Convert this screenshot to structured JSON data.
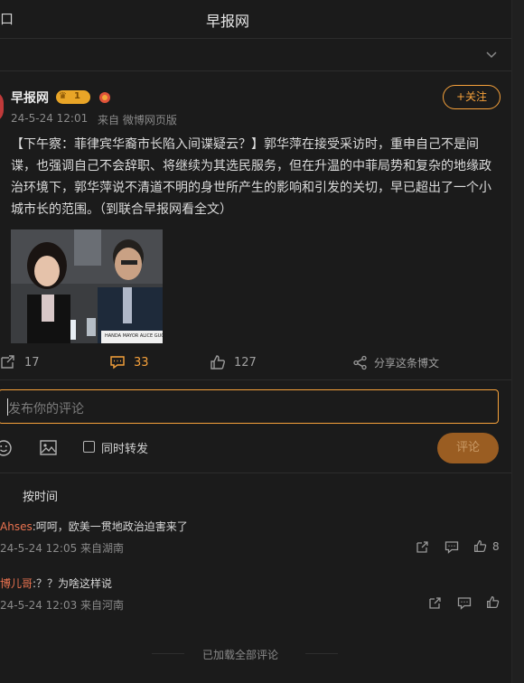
{
  "header": {
    "title": "早报网",
    "back_glyph": "口"
  },
  "post": {
    "username": "早报网",
    "vip_badge": "1",
    "time": "24-5-24 12:01",
    "source": "来自 微博网页版",
    "follow_label": "+关注",
    "content": "【下午察：菲律宾华裔市长陷入间谍疑云？】郭华萍在接受采访时，重申自己不是间谍，也强调自己不会辞职、将继续为其选民服务，但在升温的中菲局势和复杂的地缘政治环境下，郭华萍说不清道不明的身世所产生的影响和引发的关切，早已超出了一个小城市长的范围。（到联合早报网看全文）",
    "image_caption": "HANDA MAYOR ALICE GUO",
    "actions": {
      "repost": "17",
      "comment": "33",
      "like": "127",
      "share": "分享这条博文"
    }
  },
  "composer": {
    "placeholder": "发布你的评论",
    "repost_label": "同时转发",
    "submit_label": "评论"
  },
  "sort_label": "按时间",
  "comments": [
    {
      "user": "Ahses",
      "text": ":呵呵，欧美一贯地政治迫害来了",
      "meta": "24-5-24 12:05 来自湖南",
      "likes": "8"
    },
    {
      "user": "博儿哥",
      "text": ":？？为啥这样说",
      "meta": "24-5-24 12:03 来自河南",
      "likes": ""
    }
  ],
  "footer_note": "已加载全部评论",
  "colors": {
    "accent": "#f7a23b",
    "bg": "#1b1b1b",
    "text": "#d6d6d6",
    "muted": "#8a8a8a"
  }
}
